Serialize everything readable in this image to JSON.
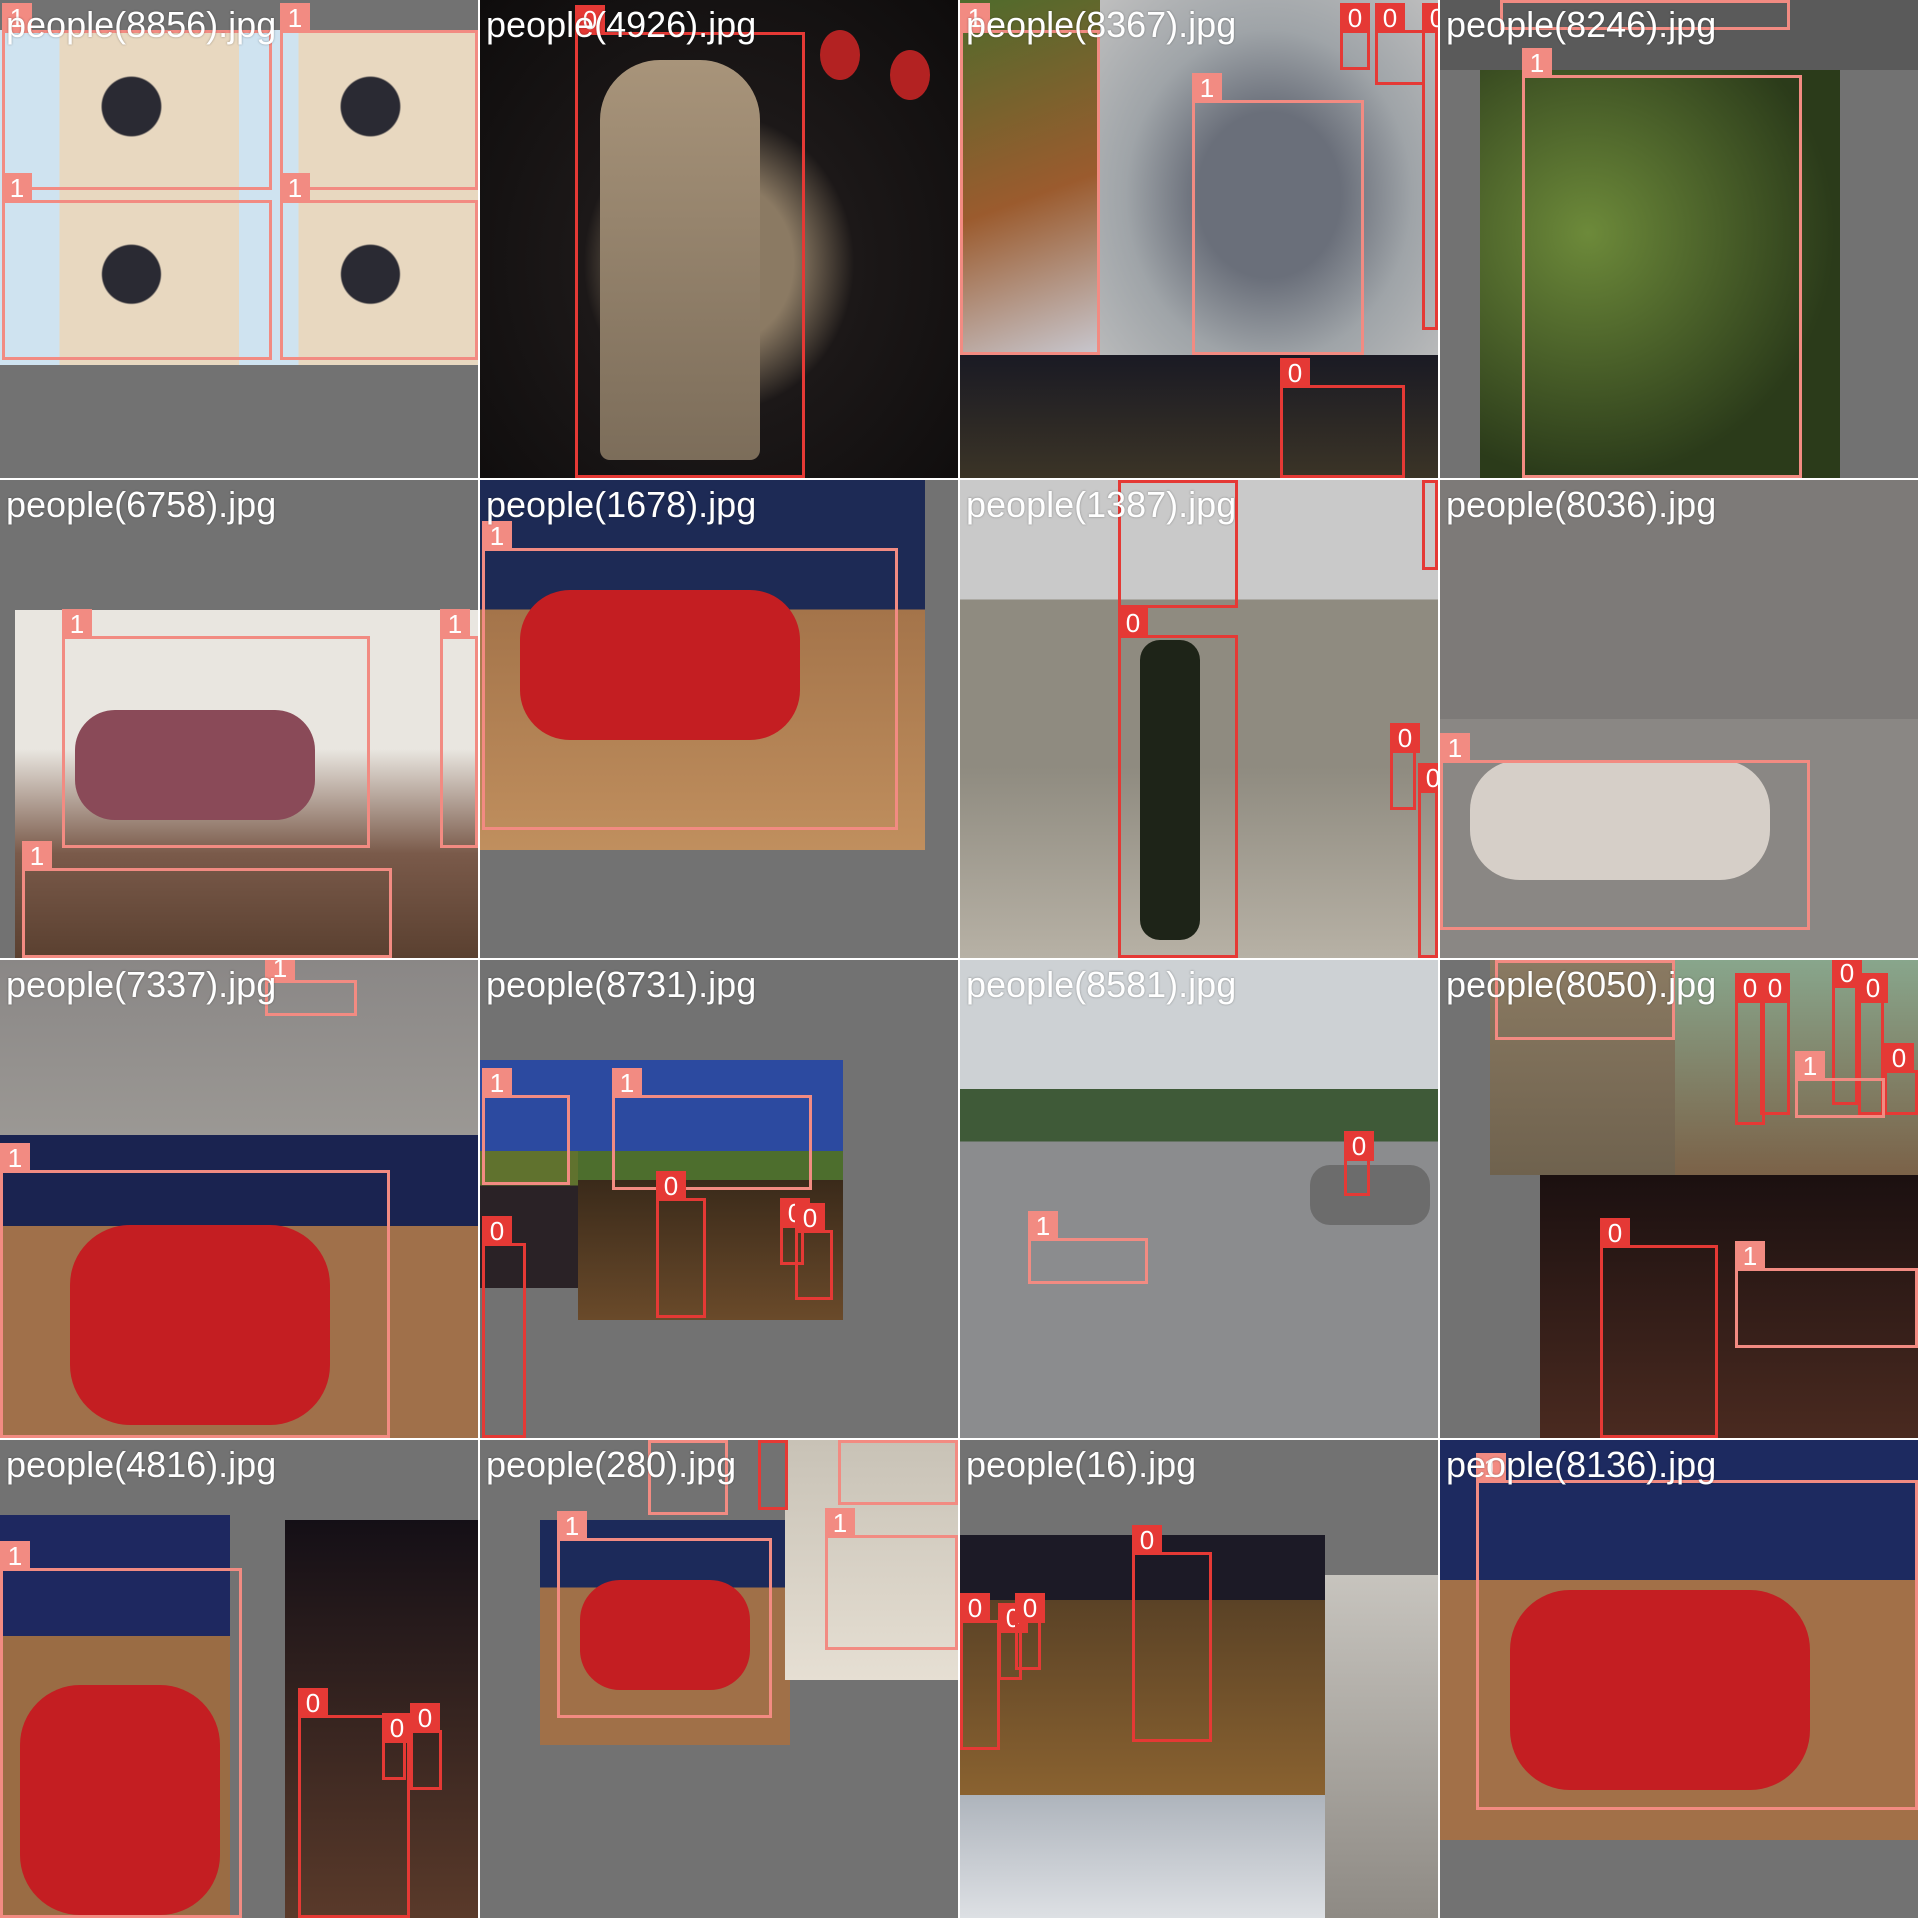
{
  "colors": {
    "class0": "#e53935",
    "class1": "#f28b82",
    "tile_bg": "#727272"
  },
  "tiles": [
    {
      "label": "people(8856).jpg",
      "boxes": [
        {
          "cls": "1"
        },
        {
          "cls": "1"
        },
        {
          "cls": "1"
        },
        {
          "cls": "1"
        }
      ]
    },
    {
      "label": "people(4926).jpg",
      "boxes": [
        {
          "cls": "0"
        }
      ]
    },
    {
      "label": "people(8367).jpg",
      "boxes": [
        {
          "cls": "1"
        },
        {
          "cls": "1"
        },
        {
          "cls": "0"
        },
        {
          "cls": "0"
        },
        {
          "cls": "0"
        },
        {
          "cls": "0"
        }
      ]
    },
    {
      "label": "people(8246).jpg",
      "boxes": [
        {
          "cls": "1"
        },
        {
          "cls": "1"
        }
      ]
    },
    {
      "label": "people(6758).jpg",
      "boxes": [
        {
          "cls": "1"
        },
        {
          "cls": "1"
        },
        {
          "cls": "1"
        }
      ]
    },
    {
      "label": "people(1678).jpg",
      "boxes": [
        {
          "cls": "1"
        }
      ]
    },
    {
      "label": "people(1387).jpg",
      "boxes": [
        {
          "cls": "0"
        },
        {
          "cls": "0"
        },
        {
          "cls": "0"
        },
        {
          "cls": "0"
        },
        {
          "cls": "0"
        }
      ]
    },
    {
      "label": "people(8036).jpg",
      "boxes": [
        {
          "cls": "1"
        }
      ]
    },
    {
      "label": "people(7337).jpg",
      "boxes": [
        {
          "cls": "1"
        },
        {
          "cls": "1"
        }
      ]
    },
    {
      "label": "people(8731).jpg",
      "boxes": [
        {
          "cls": "1"
        },
        {
          "cls": "1"
        },
        {
          "cls": "0"
        },
        {
          "cls": "0"
        },
        {
          "cls": "0"
        },
        {
          "cls": "0"
        }
      ]
    },
    {
      "label": "people(8581).jpg",
      "boxes": [
        {
          "cls": "1"
        },
        {
          "cls": "0"
        }
      ]
    },
    {
      "label": "people(8050).jpg",
      "boxes": [
        {
          "cls": "1"
        },
        {
          "cls": "0"
        },
        {
          "cls": "0"
        },
        {
          "cls": "0"
        },
        {
          "cls": "0"
        },
        {
          "cls": "0"
        },
        {
          "cls": "1"
        },
        {
          "cls": "0"
        },
        {
          "cls": "1"
        }
      ]
    },
    {
      "label": "people(4816).jpg",
      "boxes": [
        {
          "cls": "1"
        },
        {
          "cls": "0"
        },
        {
          "cls": "0"
        },
        {
          "cls": "0"
        }
      ]
    },
    {
      "label": "people(280).jpg",
      "boxes": [
        {
          "cls": "1"
        },
        {
          "cls": "0"
        },
        {
          "cls": "1"
        },
        {
          "cls": "1"
        },
        {
          "cls": "1"
        }
      ]
    },
    {
      "label": "people(16).jpg",
      "boxes": [
        {
          "cls": "0"
        },
        {
          "cls": "0"
        },
        {
          "cls": "0"
        },
        {
          "cls": "0"
        }
      ]
    },
    {
      "label": "people(8136).jpg",
      "boxes": [
        {
          "cls": "1"
        }
      ]
    }
  ]
}
